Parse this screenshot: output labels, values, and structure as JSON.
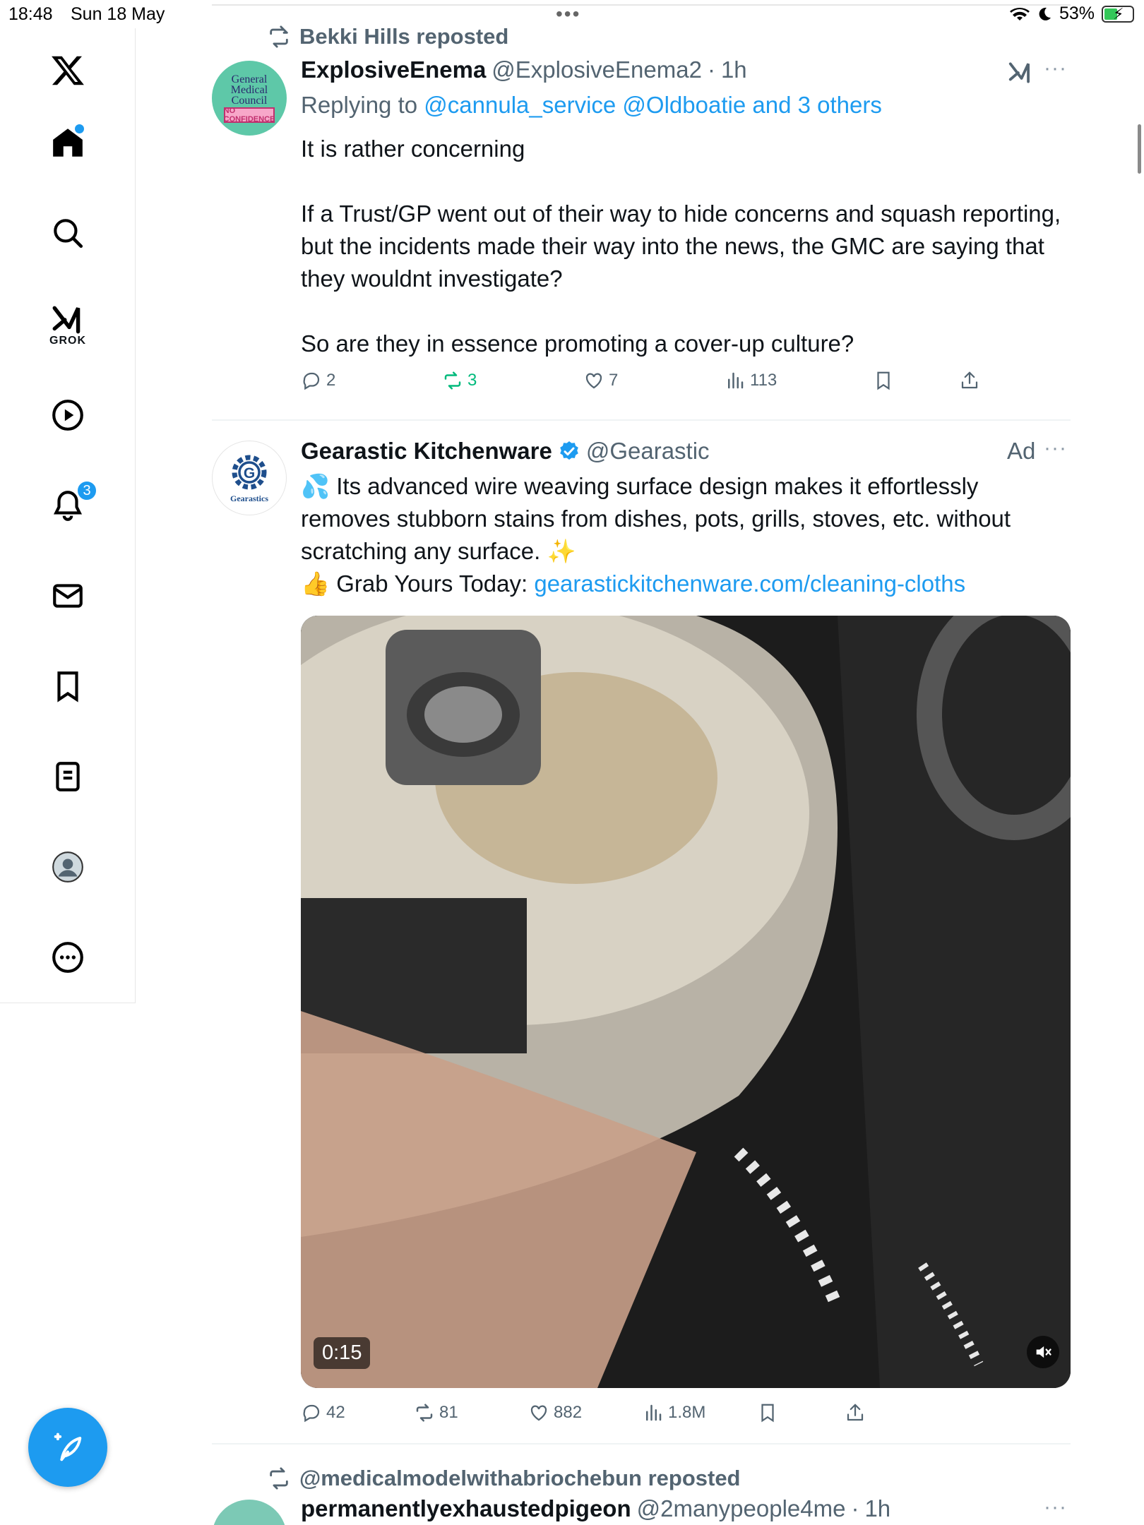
{
  "status_bar": {
    "time": "18:48",
    "date": "Sun 18 May",
    "battery": "53%",
    "battery_percent": 53
  },
  "sidebar": {
    "items": [
      {
        "name": "home",
        "label": "Home"
      },
      {
        "name": "explore",
        "label": "Explore"
      },
      {
        "name": "grok",
        "label": "GROK"
      },
      {
        "name": "video",
        "label": "Video"
      },
      {
        "name": "notifications",
        "label": "Notifications",
        "badge": "3"
      },
      {
        "name": "messages",
        "label": "Messages"
      },
      {
        "name": "bookmarks",
        "label": "Bookmarks"
      },
      {
        "name": "lists",
        "label": "Lists"
      },
      {
        "name": "profile",
        "label": "Profile"
      },
      {
        "name": "more",
        "label": "More"
      }
    ],
    "compose_icon": "compose-icon"
  },
  "tweets": [
    {
      "reposted_by": "Bekki Hills reposted",
      "avatar_text": [
        "General",
        "Medical",
        "Council"
      ],
      "avatar_stamp": "NO CONFIDENCE",
      "name": "ExplosiveEnema",
      "handle": "@ExplosiveEnema2",
      "time": "1h",
      "replying_prefix": "Replying to",
      "replying_to": "@cannula_service @Oldboatie and 3 others",
      "paragraphs": [
        "It is rather concerning",
        "If a Trust/GP went out of their way to hide concerns and squash reporting, but the incidents made their way into the news, the GMC are saying that they wouldnt investigate?",
        "So are they in essence promoting a cover-up culture?"
      ],
      "stats": {
        "replies": "2",
        "reposts": "3",
        "likes": "7",
        "views": "113"
      }
    },
    {
      "name": "Gearastic Kitchenware",
      "handle": "@Gearastic",
      "ad_label": "Ad",
      "avatar_text": "Gearastics",
      "line1": "💦 Its advanced wire weaving surface design makes it effortlessly removes stubborn stains from dishes, pots, grills, stoves, etc. without scratching any surface. ✨",
      "line2_prefix": "👍 Grab Yours Today: ",
      "link": "gearastickitchenware.com/cleaning-cloths",
      "video_duration": "0:15",
      "stats": {
        "replies": "42",
        "reposts": "81",
        "likes": "882",
        "views": "1.8M"
      }
    },
    {
      "reposted_by": "@medicalmodelwithabriochebun reposted",
      "name": "permanentlyexhaustedpigeon",
      "handle": "@2manypeople4me",
      "time": "1h"
    }
  ],
  "colors": {
    "accent": "#1d9bf0",
    "retweet_green": "#00ba7c",
    "secondary_text": "#536471"
  }
}
